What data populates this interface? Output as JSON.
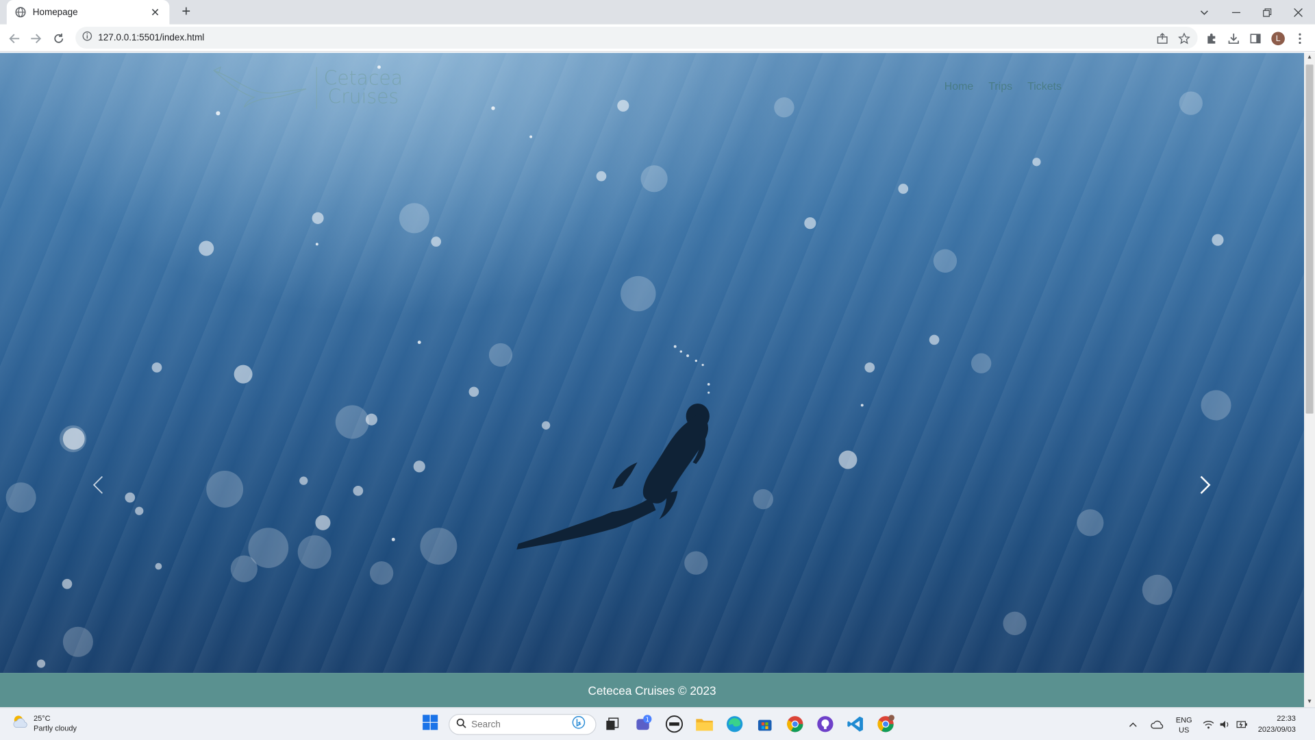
{
  "browser": {
    "tab_title": "Homepage",
    "url": "127.0.0.1:5501/index.html",
    "avatar_letter": "L"
  },
  "page": {
    "logo_line1": "Cetacea",
    "logo_line2": "Cruises",
    "nav": [
      "Home",
      "Trips",
      "Tickets"
    ],
    "footer": "Cetecea Cruises © 2023"
  },
  "taskbar": {
    "weather_temp": "25°C",
    "weather_desc": "Partly cloudy",
    "search_placeholder": "Search",
    "teams_badge": "1",
    "lang_line1": "ENG",
    "lang_line2": "US",
    "time": "22:33",
    "date": "2023/09/03"
  },
  "colors": {
    "footer_bg": "#5a9190",
    "ocean_top": "#5e8fba",
    "ocean_bottom": "#1b416d",
    "logo_text": "#6f9c98"
  }
}
